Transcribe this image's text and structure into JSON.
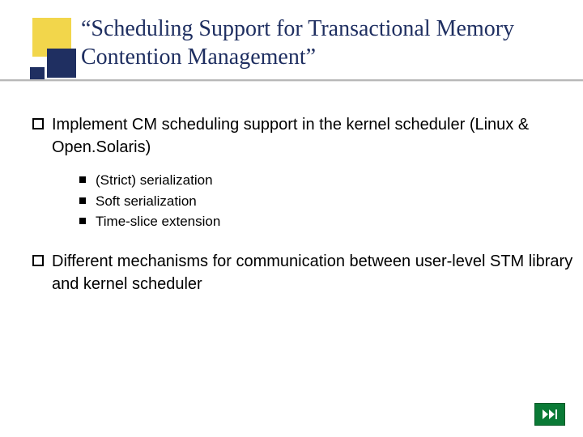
{
  "title": "“Scheduling Support for Transactional Memory Contention Management”",
  "bullets": [
    {
      "text": "Implement CM scheduling support in the kernel scheduler (Linux & Open.Solaris)",
      "subs": [
        "(Strict) serialization",
        "Soft serialization",
        "Time-slice extension"
      ]
    },
    {
      "text": "Different mechanisms for communication between user-level STM library and kernel scheduler",
      "subs": []
    }
  ],
  "colors": {
    "accent_yellow": "#f2d64b",
    "accent_navy": "#1f2f61",
    "nav_green": "#0a7a36"
  }
}
